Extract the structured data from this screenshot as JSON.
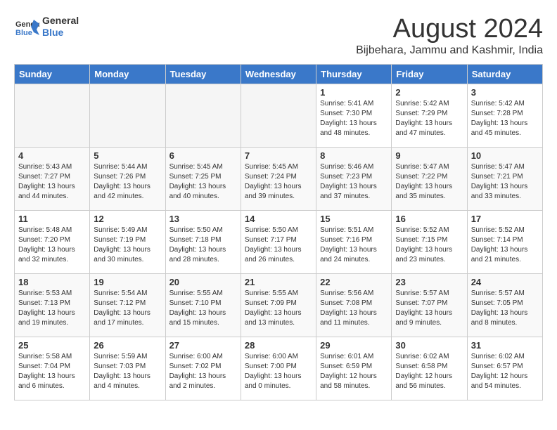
{
  "header": {
    "logo_line1": "General",
    "logo_line2": "Blue",
    "title": "August 2024",
    "subtitle": "Bijbehara, Jammu and Kashmir, India"
  },
  "weekdays": [
    "Sunday",
    "Monday",
    "Tuesday",
    "Wednesday",
    "Thursday",
    "Friday",
    "Saturday"
  ],
  "weeks": [
    [
      {
        "day": "",
        "info": "",
        "empty": true
      },
      {
        "day": "",
        "info": "",
        "empty": true
      },
      {
        "day": "",
        "info": "",
        "empty": true
      },
      {
        "day": "",
        "info": "",
        "empty": true
      },
      {
        "day": "1",
        "info": "Sunrise: 5:41 AM\nSunset: 7:30 PM\nDaylight: 13 hours\nand 48 minutes."
      },
      {
        "day": "2",
        "info": "Sunrise: 5:42 AM\nSunset: 7:29 PM\nDaylight: 13 hours\nand 47 minutes."
      },
      {
        "day": "3",
        "info": "Sunrise: 5:42 AM\nSunset: 7:28 PM\nDaylight: 13 hours\nand 45 minutes."
      }
    ],
    [
      {
        "day": "4",
        "info": "Sunrise: 5:43 AM\nSunset: 7:27 PM\nDaylight: 13 hours\nand 44 minutes."
      },
      {
        "day": "5",
        "info": "Sunrise: 5:44 AM\nSunset: 7:26 PM\nDaylight: 13 hours\nand 42 minutes."
      },
      {
        "day": "6",
        "info": "Sunrise: 5:45 AM\nSunset: 7:25 PM\nDaylight: 13 hours\nand 40 minutes."
      },
      {
        "day": "7",
        "info": "Sunrise: 5:45 AM\nSunset: 7:24 PM\nDaylight: 13 hours\nand 39 minutes."
      },
      {
        "day": "8",
        "info": "Sunrise: 5:46 AM\nSunset: 7:23 PM\nDaylight: 13 hours\nand 37 minutes."
      },
      {
        "day": "9",
        "info": "Sunrise: 5:47 AM\nSunset: 7:22 PM\nDaylight: 13 hours\nand 35 minutes."
      },
      {
        "day": "10",
        "info": "Sunrise: 5:47 AM\nSunset: 7:21 PM\nDaylight: 13 hours\nand 33 minutes."
      }
    ],
    [
      {
        "day": "11",
        "info": "Sunrise: 5:48 AM\nSunset: 7:20 PM\nDaylight: 13 hours\nand 32 minutes."
      },
      {
        "day": "12",
        "info": "Sunrise: 5:49 AM\nSunset: 7:19 PM\nDaylight: 13 hours\nand 30 minutes."
      },
      {
        "day": "13",
        "info": "Sunrise: 5:50 AM\nSunset: 7:18 PM\nDaylight: 13 hours\nand 28 minutes."
      },
      {
        "day": "14",
        "info": "Sunrise: 5:50 AM\nSunset: 7:17 PM\nDaylight: 13 hours\nand 26 minutes."
      },
      {
        "day": "15",
        "info": "Sunrise: 5:51 AM\nSunset: 7:16 PM\nDaylight: 13 hours\nand 24 minutes."
      },
      {
        "day": "16",
        "info": "Sunrise: 5:52 AM\nSunset: 7:15 PM\nDaylight: 13 hours\nand 23 minutes."
      },
      {
        "day": "17",
        "info": "Sunrise: 5:52 AM\nSunset: 7:14 PM\nDaylight: 13 hours\nand 21 minutes."
      }
    ],
    [
      {
        "day": "18",
        "info": "Sunrise: 5:53 AM\nSunset: 7:13 PM\nDaylight: 13 hours\nand 19 minutes."
      },
      {
        "day": "19",
        "info": "Sunrise: 5:54 AM\nSunset: 7:12 PM\nDaylight: 13 hours\nand 17 minutes."
      },
      {
        "day": "20",
        "info": "Sunrise: 5:55 AM\nSunset: 7:10 PM\nDaylight: 13 hours\nand 15 minutes."
      },
      {
        "day": "21",
        "info": "Sunrise: 5:55 AM\nSunset: 7:09 PM\nDaylight: 13 hours\nand 13 minutes."
      },
      {
        "day": "22",
        "info": "Sunrise: 5:56 AM\nSunset: 7:08 PM\nDaylight: 13 hours\nand 11 minutes."
      },
      {
        "day": "23",
        "info": "Sunrise: 5:57 AM\nSunset: 7:07 PM\nDaylight: 13 hours\nand 9 minutes."
      },
      {
        "day": "24",
        "info": "Sunrise: 5:57 AM\nSunset: 7:05 PM\nDaylight: 13 hours\nand 8 minutes."
      }
    ],
    [
      {
        "day": "25",
        "info": "Sunrise: 5:58 AM\nSunset: 7:04 PM\nDaylight: 13 hours\nand 6 minutes."
      },
      {
        "day": "26",
        "info": "Sunrise: 5:59 AM\nSunset: 7:03 PM\nDaylight: 13 hours\nand 4 minutes."
      },
      {
        "day": "27",
        "info": "Sunrise: 6:00 AM\nSunset: 7:02 PM\nDaylight: 13 hours\nand 2 minutes."
      },
      {
        "day": "28",
        "info": "Sunrise: 6:00 AM\nSunset: 7:00 PM\nDaylight: 13 hours\nand 0 minutes."
      },
      {
        "day": "29",
        "info": "Sunrise: 6:01 AM\nSunset: 6:59 PM\nDaylight: 12 hours\nand 58 minutes."
      },
      {
        "day": "30",
        "info": "Sunrise: 6:02 AM\nSunset: 6:58 PM\nDaylight: 12 hours\nand 56 minutes."
      },
      {
        "day": "31",
        "info": "Sunrise: 6:02 AM\nSunset: 6:57 PM\nDaylight: 12 hours\nand 54 minutes."
      }
    ]
  ]
}
